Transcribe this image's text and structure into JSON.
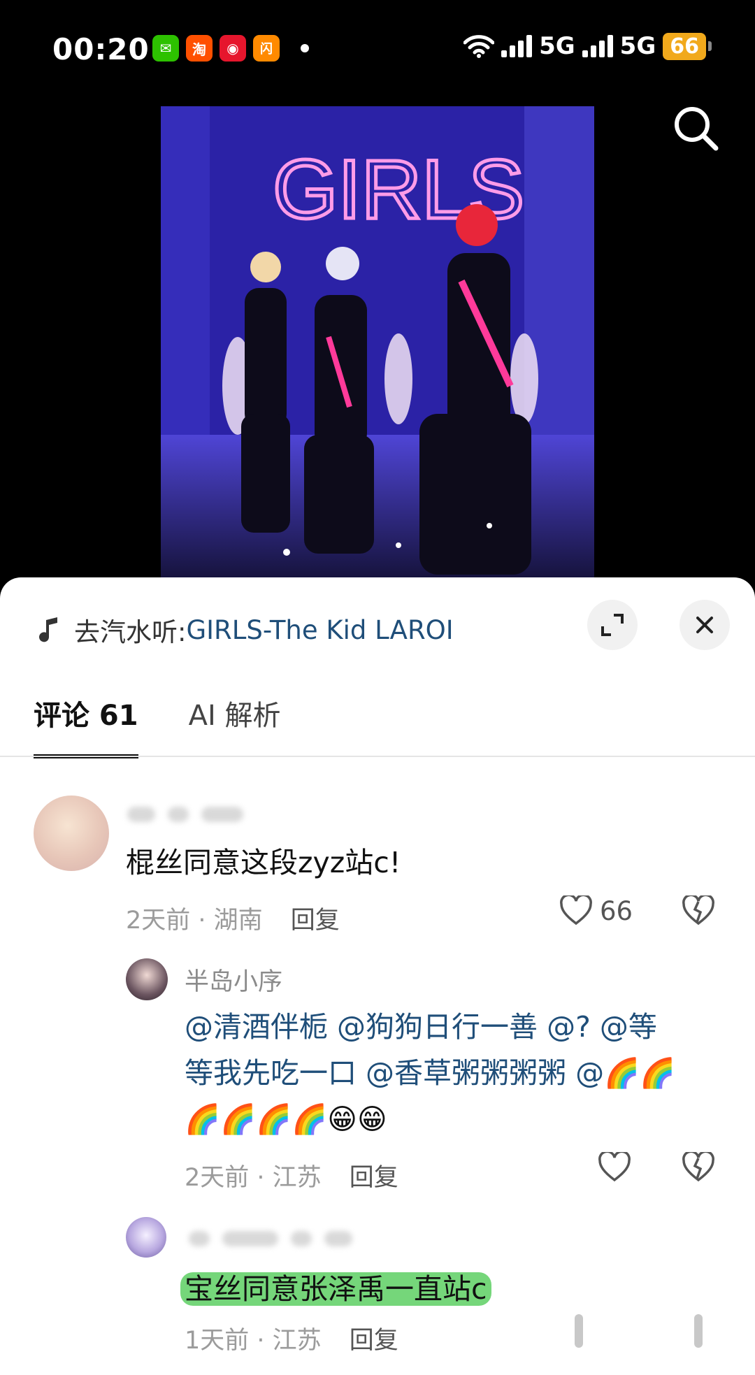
{
  "status_bar": {
    "time": "00:20",
    "apps": [
      {
        "name": "wechat",
        "glyph": "✉",
        "color": "#2dc100"
      },
      {
        "name": "taobao",
        "glyph": "淘",
        "color": "#ff5000"
      },
      {
        "name": "weibo",
        "glyph": "◉",
        "color": "#e6162d"
      },
      {
        "name": "taobao-shangou",
        "glyph": "闪",
        "color": "#ff8a00"
      }
    ],
    "network_1": "5G",
    "network_2": "5G",
    "battery": "66"
  },
  "video": {
    "sign_text": "GIRLS"
  },
  "sheet": {
    "music_prefix": "去汽水听: ",
    "music_title": "GIRLS-The Kid LAROI",
    "tabs": [
      {
        "label": "评论 61",
        "active": true
      },
      {
        "label": "AI 解析",
        "active": false
      }
    ]
  },
  "comments": [
    {
      "text": "棍丝同意这段zyz站c!",
      "time": "2天前",
      "location": "湖南",
      "reply_label": "回复",
      "likes": "66"
    },
    {
      "name": "半岛小序",
      "line1": "@清酒伴栀 @狗狗日行一善 @?  @等",
      "line2": "等我先吃一口 @香草粥粥粥粥 @🌈🌈",
      "line3": "🌈🌈🌈🌈😁😁",
      "time": "2天前",
      "location": "江苏",
      "reply_label": "回复"
    },
    {
      "text": "宝丝同意张泽禹一直站c",
      "time": "1天前",
      "location": "江苏",
      "reply_label": "回复"
    }
  ],
  "colors": {
    "accent_link": "#1f4e79",
    "highlight": "#75d67a",
    "battery": "#f1a91c"
  }
}
